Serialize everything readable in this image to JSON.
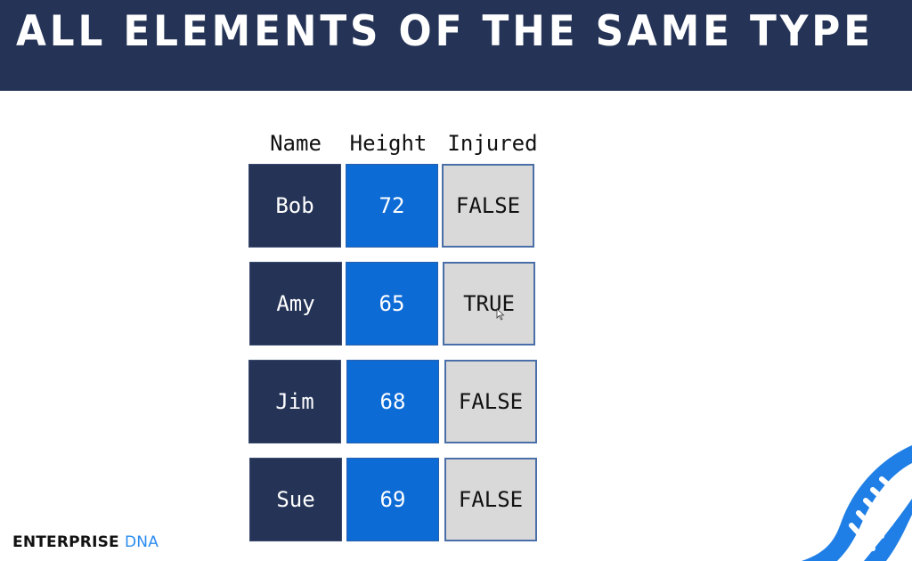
{
  "header": {
    "title": "ALL ELEMENTS OF THE SAME TYPE"
  },
  "table": {
    "columns": [
      "Name",
      "Height",
      "Injured"
    ],
    "rows": [
      {
        "name": "Bob",
        "height": "72",
        "injured": "FALSE"
      },
      {
        "name": "Amy",
        "height": "65",
        "injured": "TRUE"
      },
      {
        "name": "Jim",
        "height": "68",
        "injured": "FALSE"
      },
      {
        "name": "Sue",
        "height": "69",
        "injured": "FALSE"
      }
    ]
  },
  "logo": {
    "part1": "ENTERPRISE",
    "part2": "DNA"
  },
  "colors": {
    "header_bg": "#243356",
    "name_cell": "#243356",
    "height_cell": "#0d6bd6",
    "injured_cell": "#d9d9d9",
    "accent": "#2b8cf0"
  }
}
